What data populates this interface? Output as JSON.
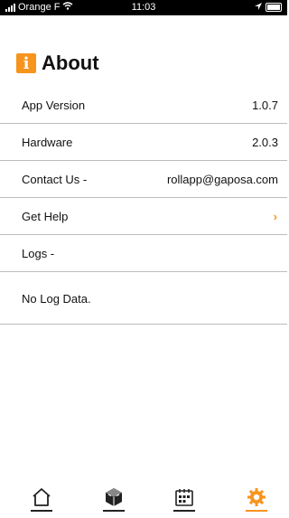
{
  "status_bar": {
    "carrier": "Orange F",
    "time": "11:03"
  },
  "header": {
    "title": "About",
    "icon": "info-icon"
  },
  "about": {
    "app_version_label": "App Version",
    "app_version_value": "1.0.7",
    "hardware_label": "Hardware",
    "hardware_value": "2.0.3",
    "contact_label": "Contact Us -",
    "contact_value": "rollapp@gaposa.com",
    "help_label": "Get Help",
    "logs_label": "Logs -",
    "log_data_text": "No Log Data."
  },
  "tab_bar": {
    "tabs": [
      {
        "icon": "home-icon"
      },
      {
        "icon": "cube-icon"
      },
      {
        "icon": "calendar-icon"
      },
      {
        "icon": "settings-gear-icon",
        "active": true
      }
    ]
  },
  "colors": {
    "accent": "#f7941d",
    "divider": "#bdbdbd"
  }
}
